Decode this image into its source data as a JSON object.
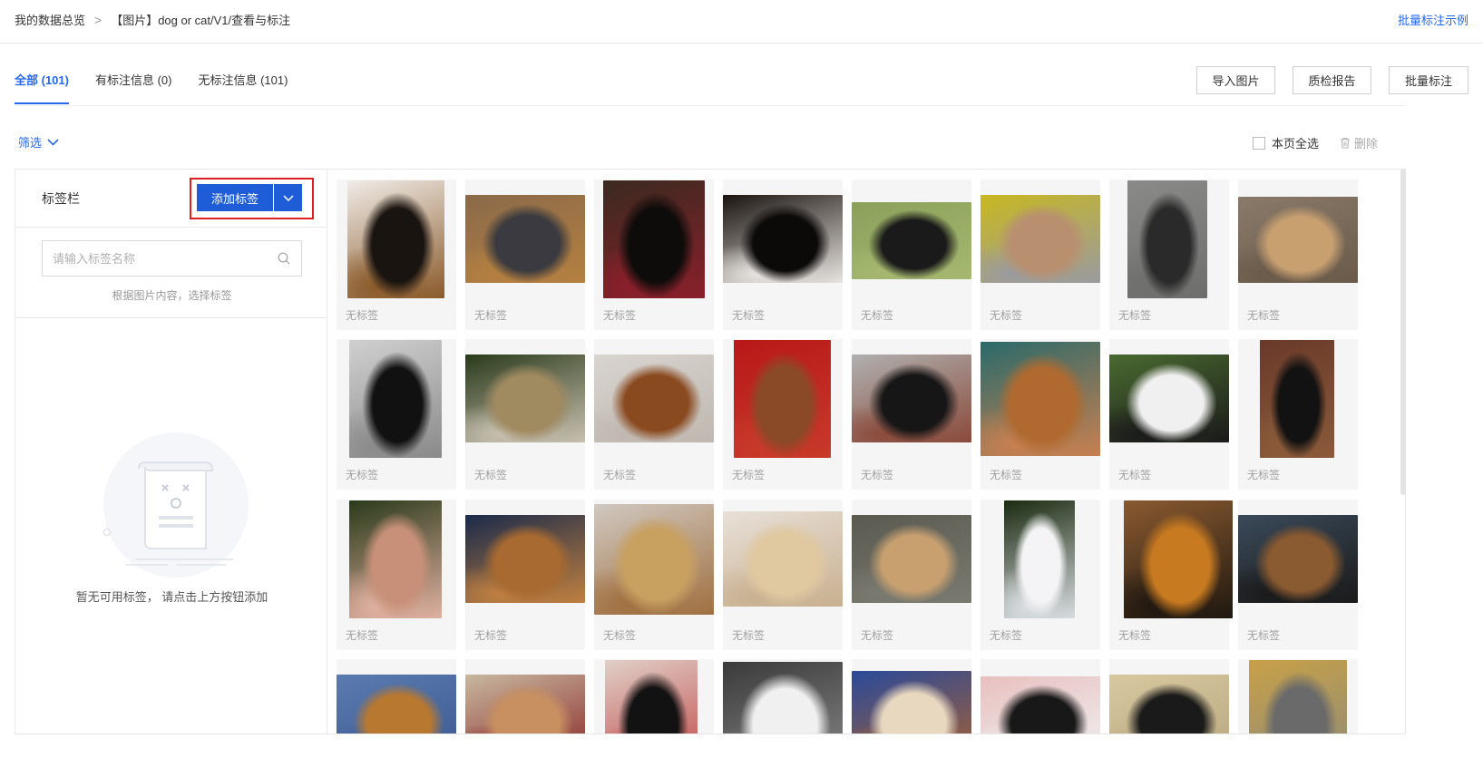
{
  "breadcrumb": {
    "root": "我的数据总览",
    "separator": ">",
    "current": "【图片】dog or cat/V1/查看与标注"
  },
  "example_link": "批量标注示例",
  "tabs": [
    {
      "label": "全部 (101)",
      "active": true
    },
    {
      "label": "有标注信息 (0)",
      "active": false
    },
    {
      "label": "无标注信息 (101)",
      "active": false
    }
  ],
  "actions": {
    "import": "导入图片",
    "report": "质检报告",
    "batch": "批量标注"
  },
  "filter": {
    "label": "筛选",
    "icon": "chevron-down-icon"
  },
  "select_all": {
    "label": "本页全选",
    "checked": false
  },
  "delete": {
    "label": "删除",
    "icon": "trash-icon"
  },
  "sidebar": {
    "title": "标签栏",
    "add_button": "添加标签",
    "search_placeholder": "请输入标签名称",
    "hint": "根据图片内容，选择标签",
    "empty_text": "暂无可用标签， 请点击上方按钮添加"
  },
  "colors": {
    "accent": "#2468f2",
    "primary_button": "#1e5cd8",
    "highlight": "#e02020",
    "card_bg": "#f5f5f5"
  },
  "thumb_label": "无标签",
  "thumbnails": [
    {
      "name": "black-tan-puppy",
      "colors": [
        "#f0ece8",
        "#1a1410",
        "#8a5a2a"
      ]
    },
    {
      "name": "small-dog-on-floor",
      "colors": [
        "#8a6a4a",
        "#3a3a40",
        "#b58040"
      ]
    },
    {
      "name": "doberman-tongue",
      "colors": [
        "#3a2a20",
        "#0e0c0a",
        "#8a1f2a"
      ]
    },
    {
      "name": "black-dog-closeup",
      "colors": [
        "#1a1410",
        "#0c0a08",
        "#e8e4e0"
      ]
    },
    {
      "name": "small-dog-grass",
      "colors": [
        "#8aa05a",
        "#1a1a1a",
        "#a6b870"
      ]
    },
    {
      "name": "dog-on-blanket",
      "colors": [
        "#c8b820",
        "#b89070",
        "#9a9aa0"
      ]
    },
    {
      "name": "schnauzer-gravel",
      "colors": [
        "#8a8a88",
        "#2a2a2a",
        "#6e6e6c"
      ]
    },
    {
      "name": "dog-with-person",
      "colors": [
        "#8a7a6a",
        "#c8a070",
        "#6a5a4a"
      ]
    },
    {
      "name": "black-puppy-fence",
      "colors": [
        "#d0d0d0",
        "#111111",
        "#8a8a8a"
      ]
    },
    {
      "name": "dog-lying-night",
      "colors": [
        "#2a3a1a",
        "#a08a60",
        "#c8c0b0"
      ]
    },
    {
      "name": "brown-puppy-bed",
      "colors": [
        "#d8d4d0",
        "#8a4a20",
        "#c0b8b0"
      ]
    },
    {
      "name": "poodle-red",
      "colors": [
        "#b81818",
        "#8a4a28",
        "#c83a2a"
      ]
    },
    {
      "name": "black-dog-snow",
      "colors": [
        "#b0b0b0",
        "#161616",
        "#8a4a3a"
      ]
    },
    {
      "name": "mastiff-smile",
      "colors": [
        "#2a6a6a",
        "#b06a30",
        "#c88050"
      ]
    },
    {
      "name": "white-dogs-grass",
      "colors": [
        "#4a6a30",
        "#f0f0f0",
        "#1a1a1a"
      ]
    },
    {
      "name": "black-dog-fence",
      "colors": [
        "#6a3a2a",
        "#121212",
        "#8a5a3a"
      ]
    },
    {
      "name": "cocker-spaniel",
      "colors": [
        "#2a3a1a",
        "#c89078",
        "#e0b0a0"
      ]
    },
    {
      "name": "chow-face",
      "colors": [
        "#1a2a4a",
        "#a86a30",
        "#c08040"
      ]
    },
    {
      "name": "tan-dog-vet",
      "colors": [
        "#d0c8c0",
        "#c8a060",
        "#a07040"
      ]
    },
    {
      "name": "fluffy-cream-dog",
      "colors": [
        "#e8e0d8",
        "#e0c8a0",
        "#c8b090"
      ]
    },
    {
      "name": "dog-leash-pavement",
      "colors": [
        "#5a5a50",
        "#c8a070",
        "#7a7a70"
      ]
    },
    {
      "name": "samoyed-white",
      "colors": [
        "#1a2a10",
        "#f4f4f6",
        "#d8dce0"
      ]
    },
    {
      "name": "two-shepherds",
      "colors": [
        "#8a5a30",
        "#c87a20",
        "#201810"
      ]
    },
    {
      "name": "shepherd-puppy",
      "colors": [
        "#3a4a5a",
        "#8a5a30",
        "#1a1a1a"
      ]
    },
    {
      "name": "dog-blue-floor",
      "colors": [
        "#5a7ab0",
        "#b87830",
        "#3a5a90"
      ]
    },
    {
      "name": "spaniel-boxes",
      "colors": [
        "#c8b8a0",
        "#c89060",
        "#8a2a2a"
      ]
    },
    {
      "name": "black-pug-hand",
      "colors": [
        "#e0d0c8",
        "#121212",
        "#c04040"
      ]
    },
    {
      "name": "white-dog-cage",
      "colors": [
        "#3a3a3a",
        "#f0f0f0",
        "#8a8a8a"
      ]
    },
    {
      "name": "small-dog-blue",
      "colors": [
        "#2a4a9a",
        "#e8d8c0",
        "#a86030"
      ]
    },
    {
      "name": "dog-kiss",
      "colors": [
        "#e8c0c0",
        "#181818",
        "#f0f0f0"
      ]
    },
    {
      "name": "dog-hallway",
      "colors": [
        "#d8c8a0",
        "#1a1a1a",
        "#b8a880"
      ]
    },
    {
      "name": "tabby-cat",
      "colors": [
        "#c8a048",
        "#6a6a6a",
        "#8a8a7a"
      ]
    }
  ]
}
